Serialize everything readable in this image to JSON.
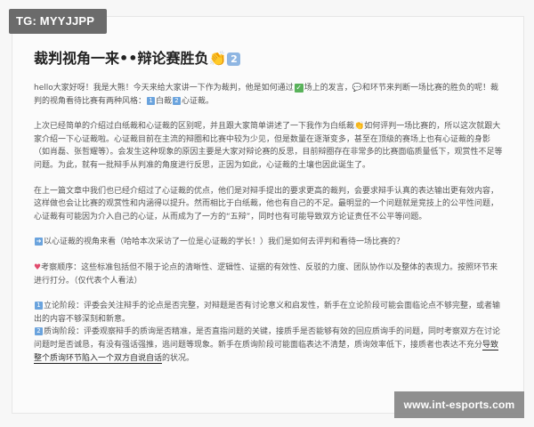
{
  "tag": "TG: MYYJJPP",
  "title": {
    "text": "裁判视角一来",
    "eyes": "••",
    "rest": "辩论赛胜负",
    "clap_icon": "clap-hands-icon",
    "num": "2"
  },
  "intro": {
    "a": "hello大家好呀！我是大熊！今天来给大家讲一下作为裁判，他是如何通过",
    "b": "场上的发言，",
    "c": "和环节来判断一场比赛的胜负的呢！裁判的视角看待比赛有两种风格：",
    "opt1_num": "1",
    "opt1": "白裁",
    "opt2_num": "2",
    "opt2": "心证裁。"
  },
  "p2": "上次已经简单的介绍过白纸裁和心证裁的区别呢，并且跟大家简单讲述了一下我作为白纸裁👏如何评判一场比赛的，所以这次就跟大家介绍一下心证裁啦。心证裁目前在主流的辩圈和比赛中较为少见，但是数量在逐渐变多，甚至在顶级的赛场上也有心证裁的身影（如肖磊、张哲耀等）。会发生这种现象的原因主要是大家对辩论赛的反思，目前辩圈存在非常多的比赛面临质量低下，观赏性不足等问题。为此，就有一批辩手从判准的角度进行反思，正因为如此，心证裁的土壤也因此诞生了。",
  "p3": "在上一篇文章中我们也已经介绍过了心证裁的优点，他们是对辩手提出的要求更高的裁判，会要求辩手认真的表达输出更有效内容，这样做也会让比赛的观赏性和内涵得以提升。然而相比于白纸裁，他也有自己的不足。最明显的一个问题就是竞技上的公平性问题，心证裁有可能因为介入自己的心证，从而成为了一方的“五辩”，同时也有可能导致双方论证责任不公平等问题。",
  "p4": {
    "icon": "right-arrow-icon",
    "text": "以心证裁的视角来看（哈哈本次采访了一位是心证裁的学长！）我们是如何去评判和看待一场比赛的？"
  },
  "p5": {
    "icon": "heart-icon",
    "text": "考察顺序：这些标准包括但不限于论点的清晰性、逻辑性、证据的有效性、反驳的力度、团队协作以及整体的表现力。按照环节来进行打分。（仅代表个人看法）"
  },
  "p6": {
    "n1": "1",
    "s1": "立论阶段：评委会关注辩手的论点是否完整，对辩题是否有讨论意义和启发性，新手在立论阶段可能会面临论点不够完整，或者输出的内容不够深刻和新意。",
    "n2": "2",
    "s2a": "质询阶段：评委观察辩手的质询是否精准，是否直指问题的关键，接质手是否能够有效的回应质询手的问题，同时考察双方在讨论问题时是否诚恳，有没有强话强推，逃问题等现象。新手在质询阶段可能面临表达不清楚，质询效率低下，接质者也表达不充分",
    "s2b": "导致整个质询环节陷入一个双方自说自话",
    "s2c": "的状况。"
  },
  "watermark": "www.int-esports.com"
}
